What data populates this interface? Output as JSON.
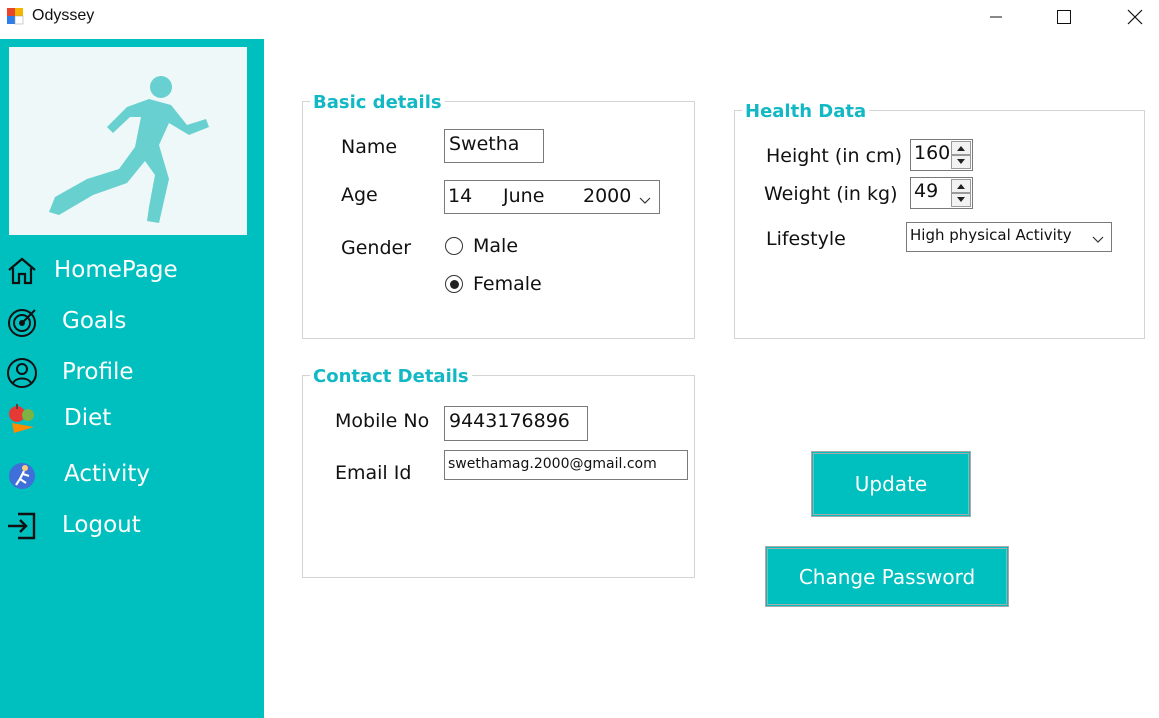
{
  "window": {
    "title": "Odyssey"
  },
  "sidebar": {
    "items": [
      {
        "label": "HomePage",
        "icon": "home-icon"
      },
      {
        "label": "Goals",
        "icon": "target-icon"
      },
      {
        "label": "Profile",
        "icon": "user-circle-icon"
      },
      {
        "label": "Diet",
        "icon": "fruit-icon"
      },
      {
        "label": "Activity",
        "icon": "activity-icon"
      },
      {
        "label": "Logout",
        "icon": "logout-icon"
      }
    ]
  },
  "basic_details": {
    "title": "Basic details",
    "name_label": "Name",
    "name_value": "Swetha",
    "age_label": "Age",
    "age_day": "14",
    "age_month": "June",
    "age_year": "2000",
    "gender_label": "Gender",
    "gender_options": [
      "Male",
      "Female"
    ],
    "gender_selected": "Female"
  },
  "health_data": {
    "title": "Health Data",
    "height_label": "Height (in cm)",
    "height_value": "160",
    "weight_label": "Weight (in kg)",
    "weight_value": "49",
    "lifestyle_label": "Lifestyle",
    "lifestyle_value": "High physical Activity"
  },
  "contact_details": {
    "title": "Contact Details",
    "mobile_label": "Mobile No",
    "mobile_value": "9443176896",
    "email_label": "Email Id",
    "email_value": "swethamag.2000@gmail.com"
  },
  "actions": {
    "update_label": "Update",
    "change_password_label": "Change Password"
  },
  "colors": {
    "accent": "#00bfbf",
    "heading": "#12b8c4"
  }
}
